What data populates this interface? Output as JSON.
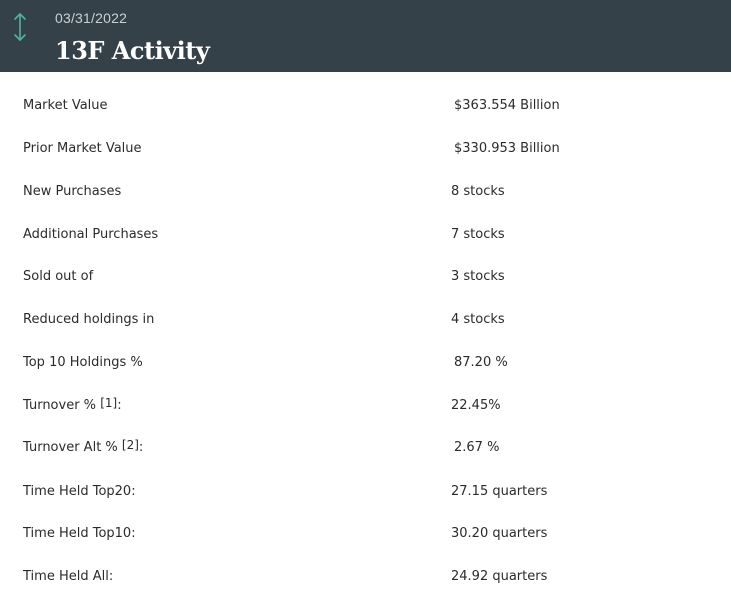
{
  "header": {
    "date": "03/31/2022",
    "title": "13F Activity",
    "icon": "up-down-arrow-icon",
    "icon_color": "#4fb3a3",
    "background": "#354148"
  },
  "rows": [
    {
      "label": "Market Value",
      "value": "$363.554 Billion"
    },
    {
      "label": "Prior Market Value",
      "value": "$330.953 Billion"
    },
    {
      "label": "New Purchases",
      "value": "8 stocks"
    },
    {
      "label": "Additional Purchases",
      "value": "7 stocks"
    },
    {
      "label": "Sold out of",
      "value": "3 stocks"
    },
    {
      "label": "Reduced holdings in",
      "value": "4 stocks"
    },
    {
      "label": "Top 10 Holdings %",
      "value": "87.20 %"
    },
    {
      "label": "Turnover %",
      "footnote": "[1]",
      "suffix": ":",
      "value": "22.45%"
    },
    {
      "label": "Turnover Alt %",
      "footnote": "[2]",
      "suffix": ":",
      "value": "2.67 %"
    },
    {
      "label": "Time Held Top20:",
      "value": "27.15 quarters"
    },
    {
      "label": "Time Held Top10:",
      "value": "30.20 quarters"
    },
    {
      "label": "Time Held All:",
      "value": "24.92 quarters"
    }
  ]
}
